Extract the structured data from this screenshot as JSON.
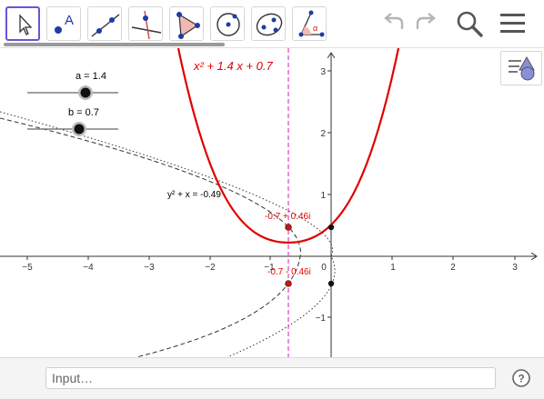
{
  "toolbar": {
    "tools": [
      {
        "name": "move-tool",
        "selected": true
      },
      {
        "name": "point-tool"
      },
      {
        "name": "line-tool"
      },
      {
        "name": "perpendicular-line-tool"
      },
      {
        "name": "polygon-tool"
      },
      {
        "name": "circle-tool"
      },
      {
        "name": "ellipse-tool"
      },
      {
        "name": "angle-tool"
      }
    ],
    "icons": [
      "undo-icon",
      "redo-icon",
      "search-icon",
      "menu-icon"
    ]
  },
  "graphics": {
    "style_bar_icon": "graphics-style-icon",
    "sliders": [
      {
        "label": "a = 1.4",
        "value": 1.4
      },
      {
        "label": "b = 0.7",
        "value": 0.7
      }
    ],
    "function_label": "x² + 1.4 x + 0.7",
    "implicit_label": "y² + x = -0.49",
    "root_labels": [
      "-0.7 + 0.46i",
      "-0.7 - 0.46i"
    ],
    "x_ticks": [
      "−5",
      "−4",
      "−3",
      "−2",
      "−1",
      "0",
      "1",
      "2",
      "3"
    ],
    "y_ticks": [
      "3",
      "2",
      "1",
      "−1"
    ],
    "colors": {
      "curve": "#e00000",
      "dashed_line": "#e040c0",
      "axes": "#333333",
      "text": "#000000"
    }
  },
  "input_bar": {
    "placeholder": "Input…",
    "help_icon": "help-icon"
  }
}
